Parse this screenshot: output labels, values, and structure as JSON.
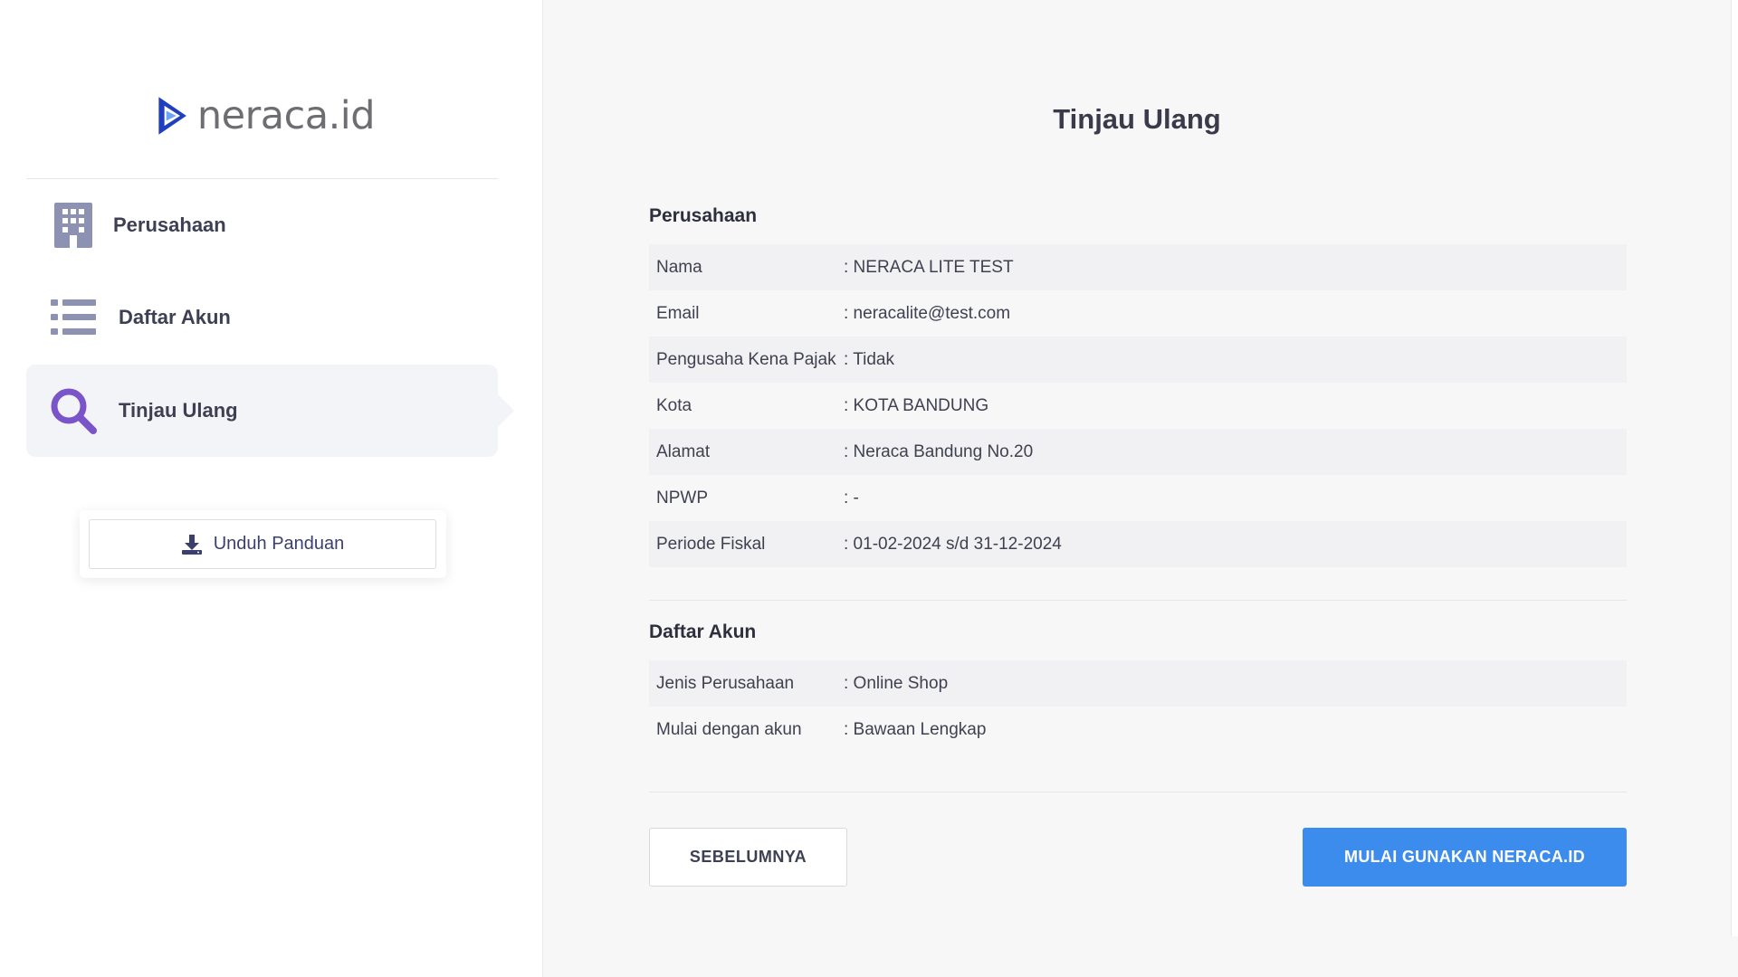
{
  "brand": {
    "name": "neraca.id",
    "accent": "#2b5fd9"
  },
  "sidebar": {
    "items": [
      {
        "label": "Perusahaan",
        "icon": "building-icon",
        "active": false
      },
      {
        "label": "Daftar Akun",
        "icon": "list-icon",
        "active": false
      },
      {
        "label": "Tinjau Ulang",
        "icon": "search-icon",
        "active": true
      }
    ],
    "download_label": "Unduh Panduan"
  },
  "main": {
    "title": "Tinjau Ulang",
    "company": {
      "heading": "Perusahaan",
      "rows": [
        {
          "key": "Nama",
          "value": ": NERACA LITE TEST"
        },
        {
          "key": "Email",
          "value": ": neracalite@test.com"
        },
        {
          "key": "Pengusaha Kena Pajak",
          "value": ": Tidak"
        },
        {
          "key": "Kota",
          "value": ": KOTA BANDUNG"
        },
        {
          "key": "Alamat",
          "value": ": Neraca Bandung No.20"
        },
        {
          "key": "NPWP",
          "value": ": -"
        },
        {
          "key": "Periode Fiskal",
          "value": ": 01-02-2024 s/d 31-12-2024"
        }
      ]
    },
    "accounts": {
      "heading": "Daftar Akun",
      "rows": [
        {
          "key": "Jenis Perusahaan",
          "value": ": Online Shop"
        },
        {
          "key": "Mulai dengan akun",
          "value": ": Bawaan Lengkap"
        }
      ]
    },
    "buttons": {
      "prev_label": "SEBELUMNYA",
      "start_label": "MULAI GUNAKAN NERACA.ID",
      "start_color": "#3b8ced"
    }
  }
}
